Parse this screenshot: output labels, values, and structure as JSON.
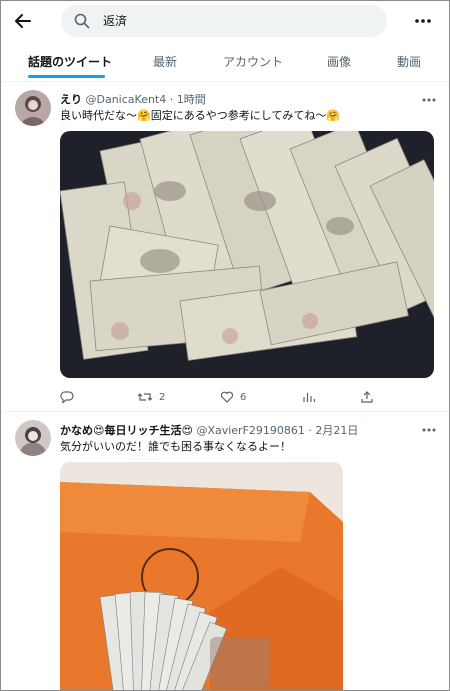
{
  "search": {
    "query": "返済"
  },
  "tabs": [
    {
      "label": "話題のツイート",
      "active": true
    },
    {
      "label": "最新",
      "active": false
    },
    {
      "label": "アカウント",
      "active": false
    },
    {
      "label": "画像",
      "active": false
    },
    {
      "label": "動画",
      "active": false
    }
  ],
  "tweets": [
    {
      "display_name": "えり",
      "handle": "@DanicaKent4",
      "time": "· 1時間",
      "text": "良い時代だな〜🤗固定にあるやつ参考にしてみてね〜🤗",
      "replies": "",
      "retweets": "2",
      "likes": "6"
    },
    {
      "display_name": "かなめ😍毎日リッチ生活😍",
      "handle": "@XavierF29190861",
      "time": "· 2月21日",
      "text": "気分がいいのだ！誰でも困る事なくなるよー！"
    }
  ],
  "colors": {
    "accent": "#1d9bf0",
    "secondary_text": "#536471",
    "divider": "#eff3f4"
  }
}
